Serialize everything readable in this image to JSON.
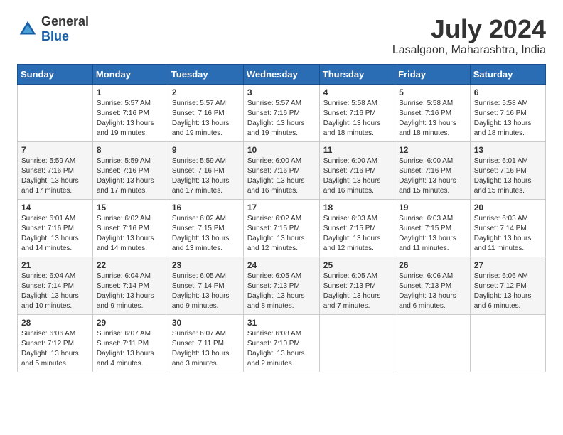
{
  "logo": {
    "general": "General",
    "blue": "Blue"
  },
  "header": {
    "month_year": "July 2024",
    "location": "Lasalgaon, Maharashtra, India"
  },
  "columns": [
    "Sunday",
    "Monday",
    "Tuesday",
    "Wednesday",
    "Thursday",
    "Friday",
    "Saturday"
  ],
  "weeks": [
    [
      {
        "day": "",
        "info": ""
      },
      {
        "day": "1",
        "info": "Sunrise: 5:57 AM\nSunset: 7:16 PM\nDaylight: 13 hours\nand 19 minutes."
      },
      {
        "day": "2",
        "info": "Sunrise: 5:57 AM\nSunset: 7:16 PM\nDaylight: 13 hours\nand 19 minutes."
      },
      {
        "day": "3",
        "info": "Sunrise: 5:57 AM\nSunset: 7:16 PM\nDaylight: 13 hours\nand 19 minutes."
      },
      {
        "day": "4",
        "info": "Sunrise: 5:58 AM\nSunset: 7:16 PM\nDaylight: 13 hours\nand 18 minutes."
      },
      {
        "day": "5",
        "info": "Sunrise: 5:58 AM\nSunset: 7:16 PM\nDaylight: 13 hours\nand 18 minutes."
      },
      {
        "day": "6",
        "info": "Sunrise: 5:58 AM\nSunset: 7:16 PM\nDaylight: 13 hours\nand 18 minutes."
      }
    ],
    [
      {
        "day": "7",
        "info": "Sunrise: 5:59 AM\nSunset: 7:16 PM\nDaylight: 13 hours\nand 17 minutes."
      },
      {
        "day": "8",
        "info": "Sunrise: 5:59 AM\nSunset: 7:16 PM\nDaylight: 13 hours\nand 17 minutes."
      },
      {
        "day": "9",
        "info": "Sunrise: 5:59 AM\nSunset: 7:16 PM\nDaylight: 13 hours\nand 17 minutes."
      },
      {
        "day": "10",
        "info": "Sunrise: 6:00 AM\nSunset: 7:16 PM\nDaylight: 13 hours\nand 16 minutes."
      },
      {
        "day": "11",
        "info": "Sunrise: 6:00 AM\nSunset: 7:16 PM\nDaylight: 13 hours\nand 16 minutes."
      },
      {
        "day": "12",
        "info": "Sunrise: 6:00 AM\nSunset: 7:16 PM\nDaylight: 13 hours\nand 15 minutes."
      },
      {
        "day": "13",
        "info": "Sunrise: 6:01 AM\nSunset: 7:16 PM\nDaylight: 13 hours\nand 15 minutes."
      }
    ],
    [
      {
        "day": "14",
        "info": "Sunrise: 6:01 AM\nSunset: 7:16 PM\nDaylight: 13 hours\nand 14 minutes."
      },
      {
        "day": "15",
        "info": "Sunrise: 6:02 AM\nSunset: 7:16 PM\nDaylight: 13 hours\nand 14 minutes."
      },
      {
        "day": "16",
        "info": "Sunrise: 6:02 AM\nSunset: 7:15 PM\nDaylight: 13 hours\nand 13 minutes."
      },
      {
        "day": "17",
        "info": "Sunrise: 6:02 AM\nSunset: 7:15 PM\nDaylight: 13 hours\nand 12 minutes."
      },
      {
        "day": "18",
        "info": "Sunrise: 6:03 AM\nSunset: 7:15 PM\nDaylight: 13 hours\nand 12 minutes."
      },
      {
        "day": "19",
        "info": "Sunrise: 6:03 AM\nSunset: 7:15 PM\nDaylight: 13 hours\nand 11 minutes."
      },
      {
        "day": "20",
        "info": "Sunrise: 6:03 AM\nSunset: 7:14 PM\nDaylight: 13 hours\nand 11 minutes."
      }
    ],
    [
      {
        "day": "21",
        "info": "Sunrise: 6:04 AM\nSunset: 7:14 PM\nDaylight: 13 hours\nand 10 minutes."
      },
      {
        "day": "22",
        "info": "Sunrise: 6:04 AM\nSunset: 7:14 PM\nDaylight: 13 hours\nand 9 minutes."
      },
      {
        "day": "23",
        "info": "Sunrise: 6:05 AM\nSunset: 7:14 PM\nDaylight: 13 hours\nand 9 minutes."
      },
      {
        "day": "24",
        "info": "Sunrise: 6:05 AM\nSunset: 7:13 PM\nDaylight: 13 hours\nand 8 minutes."
      },
      {
        "day": "25",
        "info": "Sunrise: 6:05 AM\nSunset: 7:13 PM\nDaylight: 13 hours\nand 7 minutes."
      },
      {
        "day": "26",
        "info": "Sunrise: 6:06 AM\nSunset: 7:13 PM\nDaylight: 13 hours\nand 6 minutes."
      },
      {
        "day": "27",
        "info": "Sunrise: 6:06 AM\nSunset: 7:12 PM\nDaylight: 13 hours\nand 6 minutes."
      }
    ],
    [
      {
        "day": "28",
        "info": "Sunrise: 6:06 AM\nSunset: 7:12 PM\nDaylight: 13 hours\nand 5 minutes."
      },
      {
        "day": "29",
        "info": "Sunrise: 6:07 AM\nSunset: 7:11 PM\nDaylight: 13 hours\nand 4 minutes."
      },
      {
        "day": "30",
        "info": "Sunrise: 6:07 AM\nSunset: 7:11 PM\nDaylight: 13 hours\nand 3 minutes."
      },
      {
        "day": "31",
        "info": "Sunrise: 6:08 AM\nSunset: 7:10 PM\nDaylight: 13 hours\nand 2 minutes."
      },
      {
        "day": "",
        "info": ""
      },
      {
        "day": "",
        "info": ""
      },
      {
        "day": "",
        "info": ""
      }
    ]
  ]
}
